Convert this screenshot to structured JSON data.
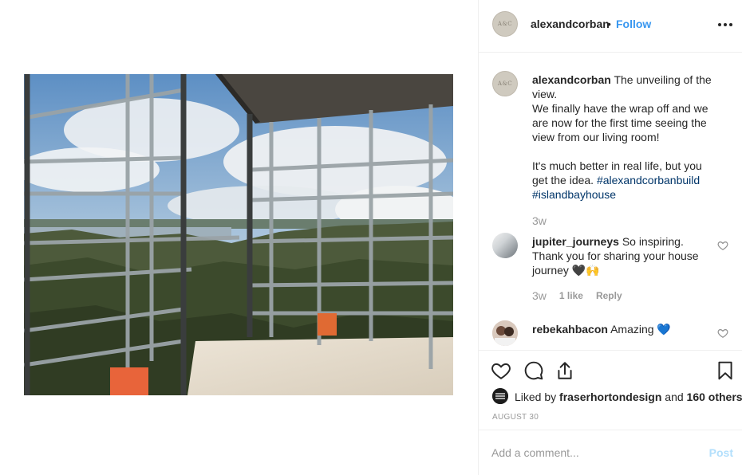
{
  "post": {
    "username": "alexandcorban",
    "dot": "•",
    "follow_label": "Follow",
    "avatar_text": "A&C"
  },
  "caption": {
    "username": "alexandcorban",
    "line1": "The unveiling of the view.",
    "line2": "We finally have the wrap off and we are now for the first time seeing the view from our living room!",
    "line3": "It's much better in real life, but you get the idea.",
    "hashtag1": "#alexandcorbanbuild",
    "hashtag2": "#islandbayhouse",
    "time": "3w"
  },
  "comments": [
    {
      "username": "jupiter_journeys",
      "text": "So inspiring. Thank you for sharing your house journey",
      "emoji": "🖤🙌",
      "time": "3w",
      "likes": "1 like",
      "reply": "Reply"
    },
    {
      "username": "rebekahbacon",
      "text": "Amazing",
      "emoji": "💙"
    }
  ],
  "likes": {
    "prefix": "Liked by",
    "user": "fraserhortondesign",
    "middle": "and",
    "others": "160 others"
  },
  "date": "AUGUST 30",
  "add_comment": {
    "placeholder": "Add a comment...",
    "post_label": "Post"
  },
  "icons": [
    "more-icon",
    "heart-icon",
    "comment-icon",
    "share-icon",
    "bookmark-icon",
    "small-heart-icon"
  ],
  "colors": {
    "link": "#3897f0",
    "hashtag": "#003569",
    "muted": "#999999",
    "post_disabled": "#b2dffc"
  }
}
